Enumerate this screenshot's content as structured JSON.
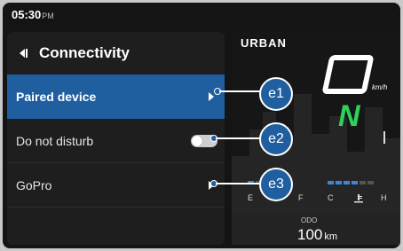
{
  "status": {
    "time": "05:30",
    "ampm": "PM"
  },
  "panel": {
    "title": "Connectivity"
  },
  "rows": [
    {
      "label": "Paired device",
      "marker": "e1"
    },
    {
      "label": "Do not disturb",
      "marker": "e2"
    },
    {
      "label": "GoPro",
      "marker": "e3"
    }
  ],
  "dash": {
    "brand": "URBAN",
    "speed_unit": "km/h",
    "gear": "N",
    "fuel_labels": [
      "E",
      "F"
    ],
    "temp_labels": [
      "C",
      "H"
    ],
    "odo_label": "ODO",
    "odo_value": "100",
    "odo_unit": "km"
  },
  "colors": {
    "accent": "#1f5fa0",
    "gear": "#2fd15a"
  }
}
